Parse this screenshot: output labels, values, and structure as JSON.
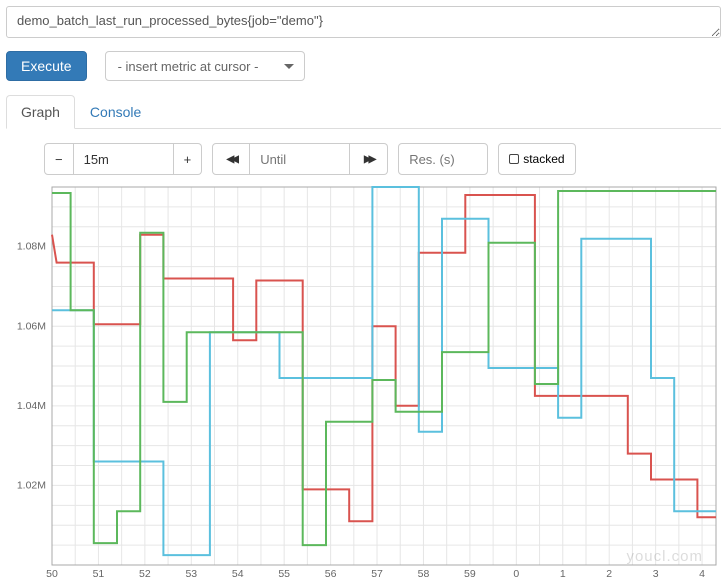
{
  "query": {
    "expression": "demo_batch_last_run_processed_bytes{job=\"demo\"}",
    "execute_label": "Execute",
    "metric_selector_label": "- insert metric at cursor -"
  },
  "tabs": {
    "graph": "Graph",
    "console": "Console"
  },
  "toolbar": {
    "minus": "−",
    "range": "15m",
    "plus": "+",
    "fast_back": "◀◀",
    "until_placeholder": "Until",
    "fast_fwd": "▶▶",
    "res_placeholder": "Res. (s)",
    "stacked_label": "stacked"
  },
  "watermark": "youcl.com",
  "chart_data": {
    "type": "line",
    "xlabel": "",
    "ylabel": "",
    "x_ticks": [
      "50",
      "51",
      "52",
      "53",
      "54",
      "55",
      "56",
      "57",
      "58",
      "59",
      "0",
      "1",
      "2",
      "3",
      "4"
    ],
    "y_ticks": [
      "1.02M",
      "1.04M",
      "1.06M",
      "1.08M"
    ],
    "ylim": [
      1000000,
      1095000
    ],
    "xlim_indices": [
      0,
      14.3
    ],
    "series": [
      {
        "name": "series-red",
        "color": "#d9534f",
        "points": [
          [
            0.0,
            1083000
          ],
          [
            0.1,
            1076000
          ],
          [
            0.9,
            1076000
          ],
          [
            0.9,
            1060500
          ],
          [
            1.9,
            1060500
          ],
          [
            1.9,
            1083000
          ],
          [
            2.4,
            1083000
          ],
          [
            2.4,
            1072000
          ],
          [
            3.9,
            1072000
          ],
          [
            3.9,
            1056500
          ],
          [
            4.4,
            1056500
          ],
          [
            4.4,
            1071500
          ],
          [
            5.4,
            1071500
          ],
          [
            5.4,
            1019000
          ],
          [
            6.4,
            1019000
          ],
          [
            6.4,
            1011000
          ],
          [
            6.9,
            1011000
          ],
          [
            6.9,
            1060000
          ],
          [
            7.4,
            1060000
          ],
          [
            7.4,
            1040000
          ],
          [
            7.9,
            1040000
          ],
          [
            7.9,
            1078500
          ],
          [
            8.9,
            1078500
          ],
          [
            8.9,
            1093000
          ],
          [
            10.4,
            1093000
          ],
          [
            10.4,
            1042500
          ],
          [
            12.4,
            1042500
          ],
          [
            12.4,
            1028000
          ],
          [
            12.9,
            1028000
          ],
          [
            12.9,
            1021500
          ],
          [
            13.9,
            1021500
          ],
          [
            13.9,
            1012000
          ],
          [
            14.3,
            1012000
          ]
        ]
      },
      {
        "name": "series-teal",
        "color": "#5bc0de",
        "points": [
          [
            0.0,
            1064000
          ],
          [
            0.9,
            1064000
          ],
          [
            0.9,
            1026000
          ],
          [
            2.4,
            1026000
          ],
          [
            2.4,
            1002500
          ],
          [
            3.4,
            1002500
          ],
          [
            3.4,
            1058500
          ],
          [
            4.9,
            1058500
          ],
          [
            4.9,
            1047000
          ],
          [
            6.9,
            1047000
          ],
          [
            6.9,
            1095000
          ],
          [
            7.9,
            1095000
          ],
          [
            7.9,
            1033500
          ],
          [
            8.4,
            1033500
          ],
          [
            8.4,
            1087000
          ],
          [
            9.4,
            1087000
          ],
          [
            9.4,
            1049500
          ],
          [
            10.9,
            1049500
          ],
          [
            10.9,
            1037000
          ],
          [
            11.4,
            1037000
          ],
          [
            11.4,
            1082000
          ],
          [
            12.9,
            1082000
          ],
          [
            12.9,
            1047000
          ],
          [
            13.4,
            1047000
          ],
          [
            13.4,
            1013500
          ],
          [
            14.3,
            1013500
          ]
        ]
      },
      {
        "name": "series-green",
        "color": "#5cb85c",
        "points": [
          [
            0.0,
            1093500
          ],
          [
            0.4,
            1093500
          ],
          [
            0.4,
            1064000
          ],
          [
            0.9,
            1064000
          ],
          [
            0.9,
            1005500
          ],
          [
            1.4,
            1005500
          ],
          [
            1.4,
            1013500
          ],
          [
            1.9,
            1013500
          ],
          [
            1.9,
            1083500
          ],
          [
            2.4,
            1083500
          ],
          [
            2.4,
            1041000
          ],
          [
            2.9,
            1041000
          ],
          [
            2.9,
            1058500
          ],
          [
            5.4,
            1058500
          ],
          [
            5.4,
            1005000
          ],
          [
            5.9,
            1005000
          ],
          [
            5.9,
            1036000
          ],
          [
            6.9,
            1036000
          ],
          [
            6.9,
            1046500
          ],
          [
            7.4,
            1046500
          ],
          [
            7.4,
            1038500
          ],
          [
            8.4,
            1038500
          ],
          [
            8.4,
            1053500
          ],
          [
            9.4,
            1053500
          ],
          [
            9.4,
            1081000
          ],
          [
            10.4,
            1081000
          ],
          [
            10.4,
            1045500
          ],
          [
            10.9,
            1045500
          ],
          [
            10.9,
            1094000
          ],
          [
            14.3,
            1094000
          ]
        ]
      }
    ]
  }
}
